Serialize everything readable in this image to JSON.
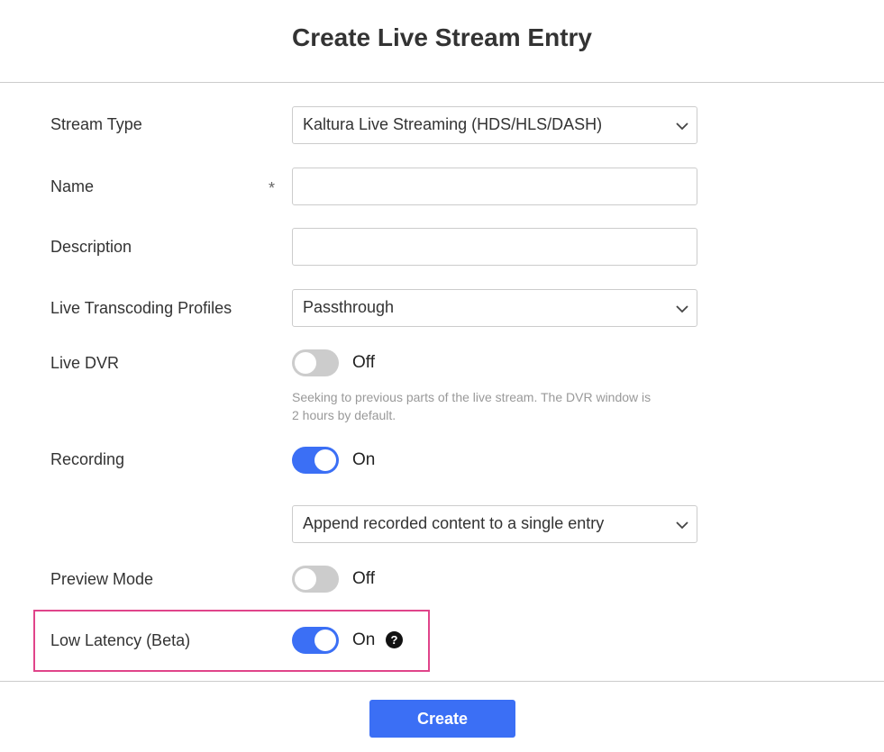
{
  "dialog": {
    "title": "Create Live Stream Entry"
  },
  "form": {
    "stream_type": {
      "label": "Stream Type",
      "value": "Kaltura Live Streaming (HDS/HLS/DASH)"
    },
    "name": {
      "label": "Name",
      "required_marker": "*",
      "value": "",
      "placeholder": ""
    },
    "description": {
      "label": "Description",
      "value": "",
      "placeholder": ""
    },
    "transcoding": {
      "label": "Live Transcoding Profiles",
      "value": "Passthrough"
    },
    "live_dvr": {
      "label": "Live DVR",
      "state": "Off",
      "hint": "Seeking to previous parts of the live stream. The DVR window is 2 hours by default."
    },
    "recording": {
      "label": "Recording",
      "state": "On",
      "option_value": "Append recorded content to a single entry"
    },
    "preview_mode": {
      "label": "Preview Mode",
      "state": "Off"
    },
    "low_latency": {
      "label": "Low Latency (Beta)",
      "state": "On",
      "help_glyph": "?"
    }
  },
  "footer": {
    "create_label": "Create"
  },
  "icons": {
    "select_arrow": "chevron-down-icon",
    "help": "question-circle-icon"
  },
  "colors": {
    "accent": "#3b6ff5",
    "toggle_off": "#cccccc",
    "highlight": "#e0448a"
  }
}
